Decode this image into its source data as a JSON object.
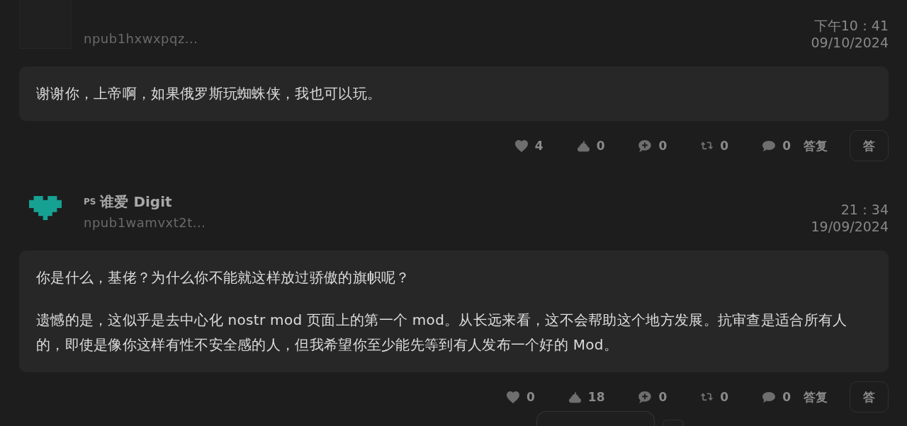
{
  "posts": [
    {
      "avatar": {
        "kind": "blank"
      },
      "author": {
        "npub": "npub1hxwxpqz..."
      },
      "time": "下午10：41",
      "date": "09/10/2024",
      "content": [
        "谢谢你，上帝啊，如果俄罗斯玩蜘蛛侠，我也可以玩。"
      ],
      "actions": [
        {
          "kind": "like",
          "count": "4"
        },
        {
          "kind": "poop",
          "count": "0"
        },
        {
          "kind": "comment",
          "count": "0"
        },
        {
          "kind": "repost",
          "count": "0"
        },
        {
          "kind": "reply",
          "count": "0",
          "label": "答复"
        }
      ],
      "reply_button": "答"
    },
    {
      "avatar": {
        "kind": "pixel-heart"
      },
      "author": {
        "badge": "PS",
        "name": "谁爱 Digit",
        "npub": "npub1wamvxt2t..."
      },
      "time": "21：34",
      "date": "19/09/2024",
      "content": [
        "你是什么，基佬？为什么你不能就这样放过骄傲的旗帜呢？",
        "遗憾的是，这似乎是去中心化 nostr mod 页面上的第一个 mod。从长远来看，这不会帮助这个地方发展。抗审查是适合所有人的，即使是像你这样有性不安全感的人，但我希望你至少能先等到有人发布一个好的 Mod。"
      ],
      "actions": [
        {
          "kind": "like",
          "count": "0"
        },
        {
          "kind": "poop",
          "count": "18"
        },
        {
          "kind": "comment",
          "count": "0"
        },
        {
          "kind": "repost",
          "count": "0"
        },
        {
          "kind": "reply",
          "count": "0",
          "label": "答复"
        }
      ],
      "reply_button": "答"
    }
  ],
  "footer": {
    "controls": [
      {
        "kind": "wide"
      },
      {
        "kind": "small"
      }
    ]
  }
}
